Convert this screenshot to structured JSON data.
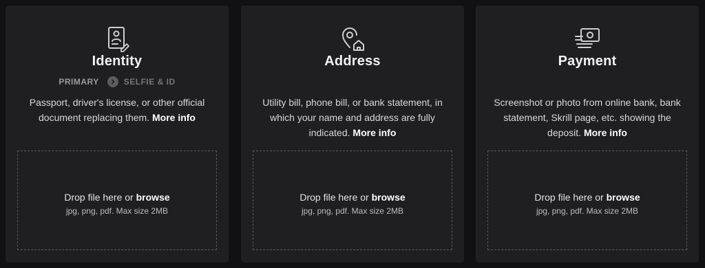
{
  "cards": {
    "identity": {
      "title": "Identity",
      "icon": "id-document-icon",
      "tabs": {
        "primary": "PRIMARY",
        "secondary": "SELFIE & ID"
      },
      "description": "Passport, driver's license, or other official document replacing them.",
      "more_info": "More info",
      "dropzone": {
        "prefix": "Drop file here or",
        "browse": "browse",
        "hint": "jpg, png, pdf. Max size 2MB"
      }
    },
    "address": {
      "title": "Address",
      "icon": "location-home-icon",
      "description": "Utility bill, phone bill, or bank statement, in which your name and address are fully indicated.",
      "more_info": "More info",
      "dropzone": {
        "prefix": "Drop file here or",
        "browse": "browse",
        "hint": "jpg, png, pdf. Max size 2MB"
      }
    },
    "payment": {
      "title": "Payment",
      "icon": "payment-card-icon",
      "description": "Screenshot or photo from online bank, bank statement, Skrill page, etc. showing the deposit.",
      "more_info": "More info",
      "dropzone": {
        "prefix": "Drop file here or",
        "browse": "browse",
        "hint": "jpg, png, pdf. Max size 2MB"
      }
    }
  },
  "colors": {
    "background": "#111113",
    "card": "#1f1f21",
    "text": "#e9e9ea",
    "muted": "#9c9ca0"
  }
}
